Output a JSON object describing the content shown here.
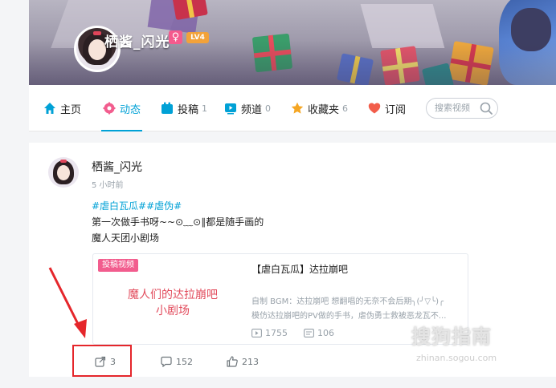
{
  "header": {
    "username": "栖酱_闪光",
    "gender_symbol": "♀",
    "level": "LV4"
  },
  "nav": {
    "items": [
      {
        "label": "主页",
        "count": "",
        "icon": "home-icon",
        "color": "#00a1d6"
      },
      {
        "label": "动态",
        "count": "",
        "icon": "dynamic-icon",
        "color": "#f25d8e",
        "active": true
      },
      {
        "label": "投稿",
        "count": "1",
        "icon": "upload-icon",
        "color": "#00a1d6"
      },
      {
        "label": "频道",
        "count": "0",
        "icon": "channel-icon",
        "color": "#00a1d6"
      },
      {
        "label": "收藏夹",
        "count": "6",
        "icon": "star-icon",
        "color": "#f5a623"
      },
      {
        "label": "订阅",
        "count": "",
        "icon": "heart-icon",
        "color": "#f25d4a"
      }
    ],
    "search_placeholder": "搜索视频"
  },
  "post": {
    "author": "栖酱_闪光",
    "time": "5 小时前",
    "tags": "#虐白瓦瓜##虐伪#",
    "text_line1": "第一次做手书呀~~⊙﹏⊙∥都是随手画的",
    "text_line2": "魔人天团小剧场",
    "video": {
      "tag": "投稿视频",
      "cover_line1": "魔人们的达拉崩吧",
      "cover_line2": "小剧场",
      "title": "【虐白瓦瓜】达拉崩吧",
      "desc_line1": "自制 BGM：达拉崩吧 想翻唱的无奈不会后期╮(╯▽╰)╭",
      "desc_line2": "模仿达拉崩吧的PV做的手书，虐伪勇士救被恶龙瓦不...",
      "plays": "1755",
      "danmaku": "106"
    },
    "actions": {
      "share": "3",
      "comments": "152",
      "likes": "213"
    }
  },
  "watermark": {
    "main": "搜狗指南",
    "sub": "zhinan.sogou.com"
  },
  "colors": {
    "accent": "#00a1d6",
    "pink": "#f25d8e",
    "annotation_red": "#e5262b"
  }
}
